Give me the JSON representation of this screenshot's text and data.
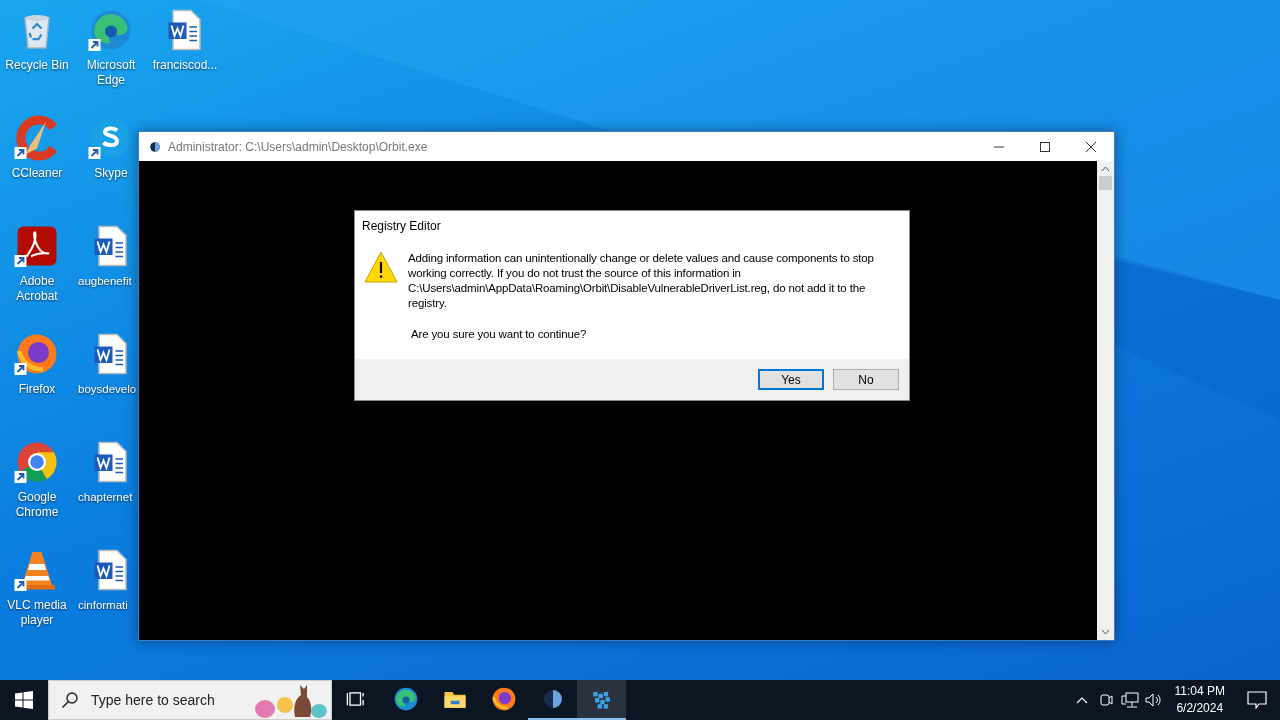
{
  "desktop_icons": [
    {
      "label": "Recycle Bin",
      "kind": "recycle",
      "shortcut": false
    },
    {
      "label": "CCleaner",
      "kind": "ccleaner",
      "shortcut": true
    },
    {
      "label": "Adobe Acrobat",
      "kind": "acrobat",
      "shortcut": true
    },
    {
      "label": "Firefox",
      "kind": "firefox",
      "shortcut": true
    },
    {
      "label": "Google Chrome",
      "kind": "chrome",
      "shortcut": true
    },
    {
      "label": "VLC media player",
      "kind": "vlc",
      "shortcut": true
    },
    {
      "label": "Microsoft Edge",
      "kind": "edge",
      "shortcut": true
    },
    {
      "label": "Skype",
      "kind": "skype",
      "shortcut": true
    },
    {
      "label": "augbenefit",
      "kind": "word",
      "shortcut": false
    },
    {
      "label": "boysdevelo",
      "kind": "word",
      "shortcut": false
    },
    {
      "label": "chapternet",
      "kind": "word",
      "shortcut": false
    },
    {
      "label": "cinformati",
      "kind": "word",
      "shortcut": false
    },
    {
      "label": "franciscod...",
      "kind": "word",
      "shortcut": false
    }
  ],
  "console_window": {
    "title": "Administrator: C:\\Users\\admin\\Desktop\\Orbit.exe"
  },
  "dialog": {
    "title": "Registry Editor",
    "message": "Adding information can unintentionally change or delete values and cause components to stop working correctly. If you do not trust the source of this information in C:\\Users\\admin\\AppData\\Roaming\\Orbit\\DisableVulnerableDriverList.reg, do not add it to the registry.",
    "question": "Are you sure you want to continue?",
    "buttons": [
      {
        "label": "Yes",
        "default": true
      },
      {
        "label": "No",
        "default": false
      }
    ]
  },
  "taskbar": {
    "search": {
      "placeholder": "Type here to search"
    },
    "apps": [
      {
        "kind": "taskview",
        "running": false,
        "active": false
      },
      {
        "kind": "edge",
        "running": false,
        "active": false
      },
      {
        "kind": "explorer",
        "running": false,
        "active": false
      },
      {
        "kind": "firefox",
        "running": false,
        "active": false
      },
      {
        "kind": "orbit",
        "running": true,
        "active": false
      },
      {
        "kind": "regedit",
        "running": true,
        "active": true
      }
    ],
    "time": "11:04 PM",
    "date": "6/2/2024"
  }
}
